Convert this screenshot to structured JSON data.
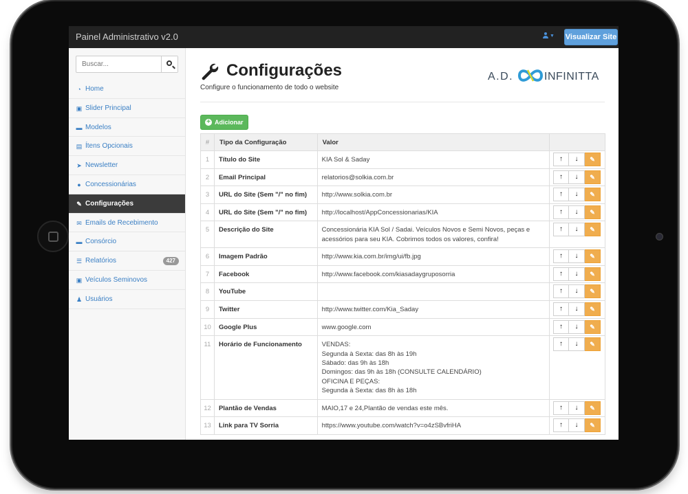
{
  "app": {
    "brand": "Painel Administrativo v2.0",
    "visit_label": "Visualizar Site"
  },
  "search": {
    "placeholder": "Buscar..."
  },
  "sidebar": {
    "items": [
      {
        "label": "Home",
        "icon": "dashboard-icon"
      },
      {
        "label": "Slider Principal",
        "icon": "images-icon"
      },
      {
        "label": "Modelos",
        "icon": "car-icon"
      },
      {
        "label": "Ítens Opcionais",
        "icon": "file-icon"
      },
      {
        "label": "Newsletter",
        "icon": "send-icon"
      },
      {
        "label": "Concessionárias",
        "icon": "map-marker-icon"
      },
      {
        "label": "Configurações",
        "icon": "wrench-icon",
        "active": true
      },
      {
        "label": "Emails de Recebimento",
        "icon": "envelope-icon"
      },
      {
        "label": "Consórcio",
        "icon": "car-icon"
      },
      {
        "label": "Relatórios",
        "icon": "list-icon",
        "badge": "427"
      },
      {
        "label": "Veículos Seminovos",
        "icon": "images-icon"
      },
      {
        "label": "Usuários",
        "icon": "users-icon"
      }
    ]
  },
  "page": {
    "title": "Configurações",
    "subtitle": "Configure o funcionamento de todo o website",
    "logo_text": "A.D. INFINITTA",
    "add_label": "Adicionar"
  },
  "table": {
    "headers": [
      "#",
      "Tipo da Configuração",
      "Valor"
    ],
    "rows": [
      {
        "n": "1",
        "type": "Título do Site",
        "value": "KIA Sol & Saday"
      },
      {
        "n": "2",
        "type": "Email Principal",
        "value": "relatorios@solkia.com.br"
      },
      {
        "n": "3",
        "type": "URL do Site (Sem \"/\" no fim)",
        "value": "http://www.solkia.com.br"
      },
      {
        "n": "4",
        "type": "URL do Site (Sem \"/\" no fim)",
        "value": "http://localhost/AppConcessionarias/KIA"
      },
      {
        "n": "5",
        "type": "Descrição do Site",
        "value": "Concessionária KIA Sol / Sadai. Veículos Novos e Semi Novos, peças e\nacessórios para seu KIA. Cobrimos todos os valores, confira!"
      },
      {
        "n": "6",
        "type": "Imagem Padrão",
        "value": "http://www.kia.com.br/img/ui/fb.jpg"
      },
      {
        "n": "7",
        "type": "Facebook",
        "value": "http://www.facebook.com/kiasadaygruposorria"
      },
      {
        "n": "8",
        "type": "YouTube",
        "value": ""
      },
      {
        "n": "9",
        "type": "Twitter",
        "value": "http://www.twitter.com/Kia_Saday"
      },
      {
        "n": "10",
        "type": "Google Plus",
        "value": "www.google.com"
      },
      {
        "n": "11",
        "type": "Horário de Funcionamento",
        "value": "VENDAS:\nSegunda à Sexta: das 8h às 19h\nSábado: das 9h às 18h\nDomingos: das 9h às 18h (CONSULTE CALENDÁRIO)\nOFICINA E PEÇAS:\nSegunda à Sexta: das 8h às 18h"
      },
      {
        "n": "12",
        "type": "Plantão de Vendas",
        "value": "MAIO,17 e 24,Plantão de vendas este mês."
      },
      {
        "n": "13",
        "type": "Link para TV Sorria",
        "value": "https://www.youtube.com/watch?v=o4zSBvfriHA"
      }
    ]
  },
  "colors": {
    "topbar": "#222222",
    "link": "#3a7fc4",
    "primary": "#5fa0dc",
    "success": "#5cb85c",
    "warning": "#f0ad4e",
    "active_nav": "#3b3b3b"
  }
}
